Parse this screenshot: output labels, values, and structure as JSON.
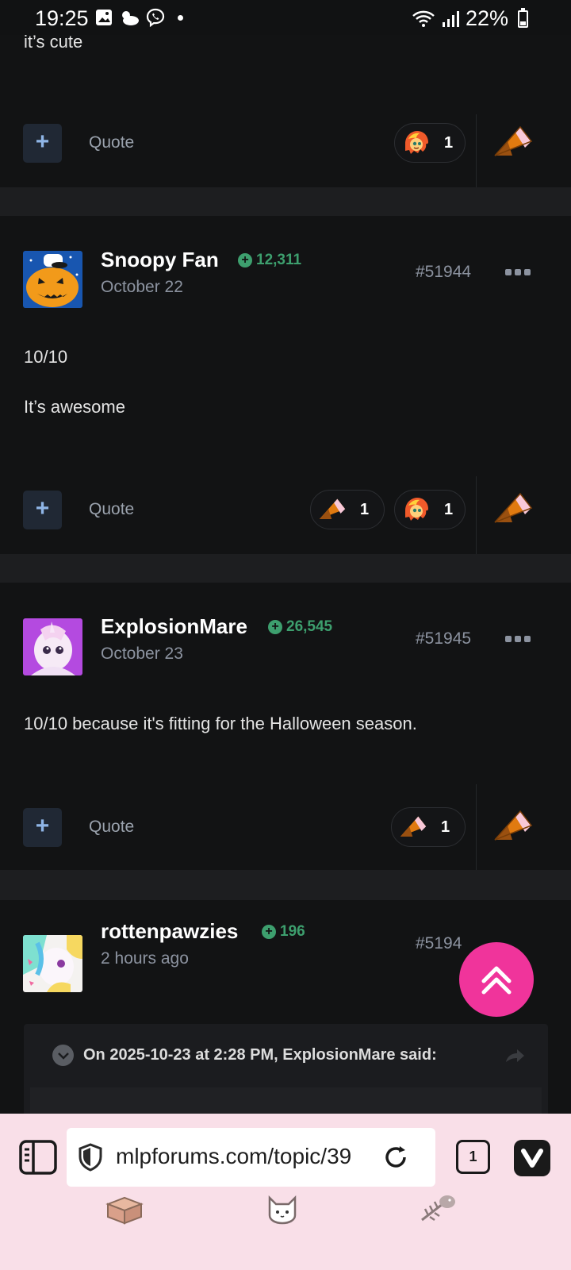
{
  "status_bar": {
    "time": "19:25",
    "battery": "22%"
  },
  "posts": [
    {
      "body": [
        "it’s cute"
      ],
      "actions": {
        "plus": "+",
        "quote_label": "Quote"
      },
      "reactions": [
        {
          "icon": "sunset-pony-reaction-icon",
          "count": "1"
        }
      ]
    },
    {
      "author": "Snoopy Fan",
      "reputation": "12,311",
      "date": "October 22",
      "post_number": "#51944",
      "body": [
        "10/10",
        "It’s awesome"
      ],
      "actions": {
        "plus": "+",
        "quote_label": "Quote"
      },
      "reactions": [
        {
          "icon": "candy-corn-reaction-icon",
          "count": "1"
        },
        {
          "icon": "sunset-pony-reaction-icon",
          "count": "1"
        }
      ]
    },
    {
      "author": "ExplosionMare",
      "reputation": "26,545",
      "date": "October 23",
      "post_number": "#51945",
      "body": [
        "10/10 because it's fitting for the Halloween season."
      ],
      "actions": {
        "plus": "+",
        "quote_label": "Quote"
      },
      "reactions": [
        {
          "icon": "candy-corn-reaction-icon",
          "count": "1"
        }
      ]
    },
    {
      "author": "rottenpawzies",
      "reputation": "196",
      "date": "2 hours ago",
      "post_number": "#5194",
      "quote_header": "On 2025-10-23 at 2:28 PM, ExplosionMare said:"
    }
  ],
  "browser": {
    "url": "mlpforums.com/topic/39",
    "tab_count": "1"
  },
  "colors": {
    "background": "#111213",
    "accent_fab": "#f0349b",
    "reputation_green": "#3d9f6e",
    "browser_bar": "#f9dfe8"
  }
}
